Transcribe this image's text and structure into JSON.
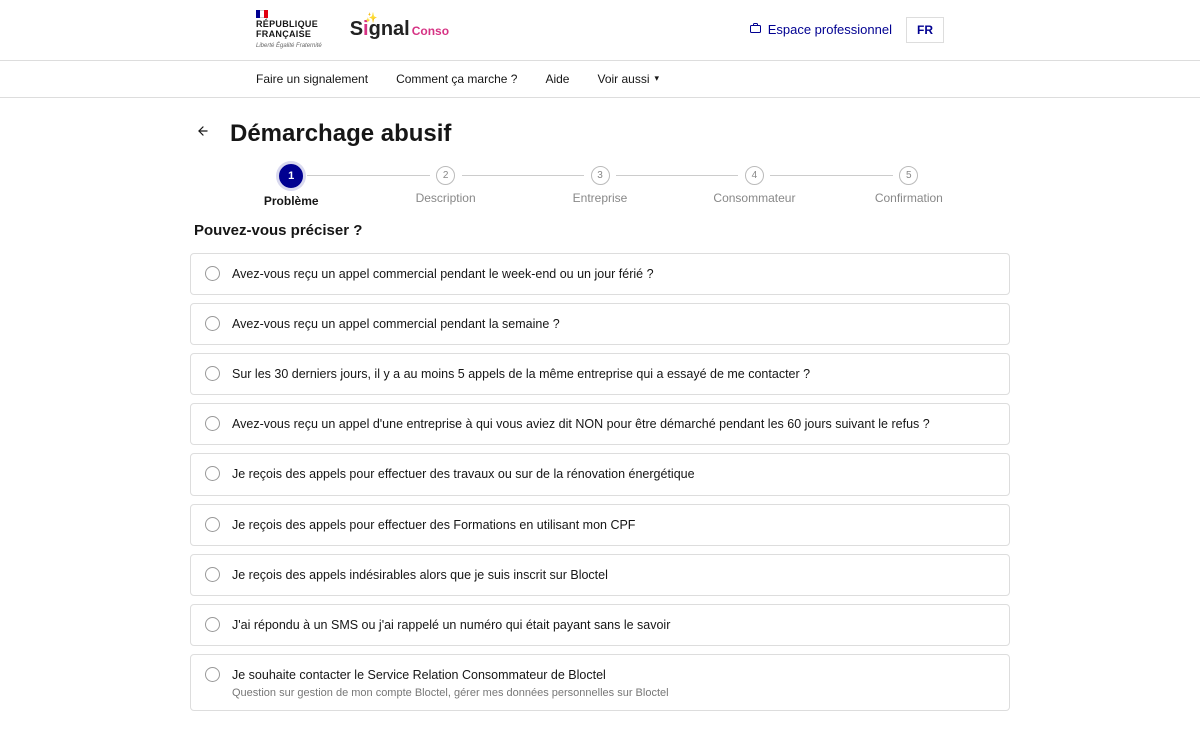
{
  "header": {
    "gov_label_1": "RÉPUBLIQUE",
    "gov_label_2": "FRANÇAISE",
    "gov_motto": "Liberté\nÉgalité\nFraternité",
    "logo_main": "S",
    "logo_i": "i",
    "logo_rest": "gnal",
    "logo_conso": "Conso",
    "pro_link": "Espace professionnel",
    "lang": "FR"
  },
  "nav": {
    "items": [
      "Faire un signalement",
      "Comment ça marche ?",
      "Aide",
      "Voir aussi"
    ]
  },
  "page": {
    "title": "Démarchage abusif",
    "question": "Pouvez-vous préciser ?"
  },
  "steps": [
    {
      "num": "1",
      "label": "Problème"
    },
    {
      "num": "2",
      "label": "Description"
    },
    {
      "num": "3",
      "label": "Entreprise"
    },
    {
      "num": "4",
      "label": "Consommateur"
    },
    {
      "num": "5",
      "label": "Confirmation"
    }
  ],
  "options": [
    {
      "text": "Avez-vous reçu un appel commercial pendant le week-end ou un jour férié ?",
      "sub": ""
    },
    {
      "text": "Avez-vous reçu un appel commercial pendant la semaine ?",
      "sub": ""
    },
    {
      "text": "Sur les 30 derniers jours, il y a au moins 5 appels de la même entreprise qui a essayé de me contacter ?",
      "sub": ""
    },
    {
      "text": "Avez-vous reçu un appel d'une entreprise à qui vous aviez dit NON pour être démarché pendant les 60 jours suivant le refus ?",
      "sub": ""
    },
    {
      "text": "Je reçois des appels pour effectuer des travaux ou sur de la rénovation énergétique",
      "sub": ""
    },
    {
      "text": "Je reçois des appels pour effectuer des Formations en utilisant mon CPF",
      "sub": ""
    },
    {
      "text": "Je reçois des appels indésirables alors que je suis inscrit sur Bloctel",
      "sub": ""
    },
    {
      "text": "J'ai répondu à un SMS ou j'ai rappelé un numéro qui était payant sans le savoir",
      "sub": ""
    },
    {
      "text": "Je souhaite contacter le Service Relation Consommateur de Bloctel",
      "sub": "Question sur gestion de mon compte Bloctel, gérer mes données personnelles sur Bloctel"
    }
  ]
}
